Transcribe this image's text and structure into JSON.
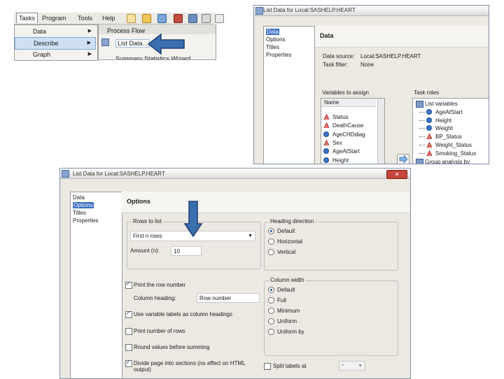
{
  "menu": {
    "items": [
      "Tasks",
      "Program",
      "Tools",
      "Help"
    ],
    "dropdown": [
      {
        "label": "Data",
        "arrow": "▶"
      },
      {
        "label": "Describe",
        "arrow": "▶"
      },
      {
        "label": "Graph",
        "arrow": "▶"
      }
    ],
    "submenu": [
      {
        "label": "Process Flow"
      },
      {
        "label": "List Data..."
      },
      {
        "label": "Summary Statistics Wizard"
      }
    ]
  },
  "top_dialog": {
    "title": "List Data for Local:SASHELP.HEART",
    "nav": [
      "Data",
      "Options",
      "Titles",
      "Properties"
    ],
    "section": "Data",
    "data_source_label": "Data source:",
    "data_source_value": "Local:SASHELP.HEART",
    "task_filter_label": "Task filter:",
    "task_filter_value": "None",
    "vars_label": "Variables to assign",
    "roles_label": "Task roles",
    "vars_header": "Name",
    "variables": [
      {
        "name": "Status",
        "type": "char"
      },
      {
        "name": "DeathCause",
        "type": "char"
      },
      {
        "name": "AgeCHDdiag",
        "type": "num"
      },
      {
        "name": "Sex",
        "type": "char"
      },
      {
        "name": "AgeAtStart",
        "type": "num"
      },
      {
        "name": "Height",
        "type": "num"
      }
    ],
    "roles_title": "List variables",
    "roles": [
      {
        "name": "AgeAtStart",
        "type": "num"
      },
      {
        "name": "Height",
        "type": "num"
      },
      {
        "name": "Weight",
        "type": "num"
      },
      {
        "name": "BP_Status",
        "type": "char"
      },
      {
        "name": "Weight_Status",
        "type": "char"
      },
      {
        "name": "Smoking_Status",
        "type": "char"
      }
    ],
    "roles_group": "Group analysis by"
  },
  "bottom_dialog": {
    "title": "List Data for Local:SASHELP.HEART",
    "close_glyph": "✕",
    "nav": [
      "Data",
      "Options",
      "Titles",
      "Properties"
    ],
    "section": "Options",
    "rows_group": "Rows to list",
    "rows_value": "First n rows",
    "amount_label": "Amount (n):",
    "amount_value": "10",
    "heading_group": "Heading direction",
    "heading_options": [
      "Default",
      "Horizontal",
      "Vertical"
    ],
    "print_row_number": "Print the row number",
    "column_heading_label": "Column heading:",
    "column_heading_value": "Row number",
    "use_labels": "Use variable labels as column headings",
    "print_rows": "Print number of rows",
    "round_values": "Round values before summing",
    "divide_pages": "Divide page into sections (no effect on HTML output)",
    "width_group": "Column width",
    "width_options": [
      "Default",
      "Full",
      "Minimum",
      "Uniform",
      "Uniform by"
    ],
    "split_labels": "Split labels at",
    "split_value": "*"
  },
  "colors": {
    "arrow": "#3a6fb0",
    "arrow_border": "#1f3f6e",
    "selected": "#3a6fc4"
  }
}
